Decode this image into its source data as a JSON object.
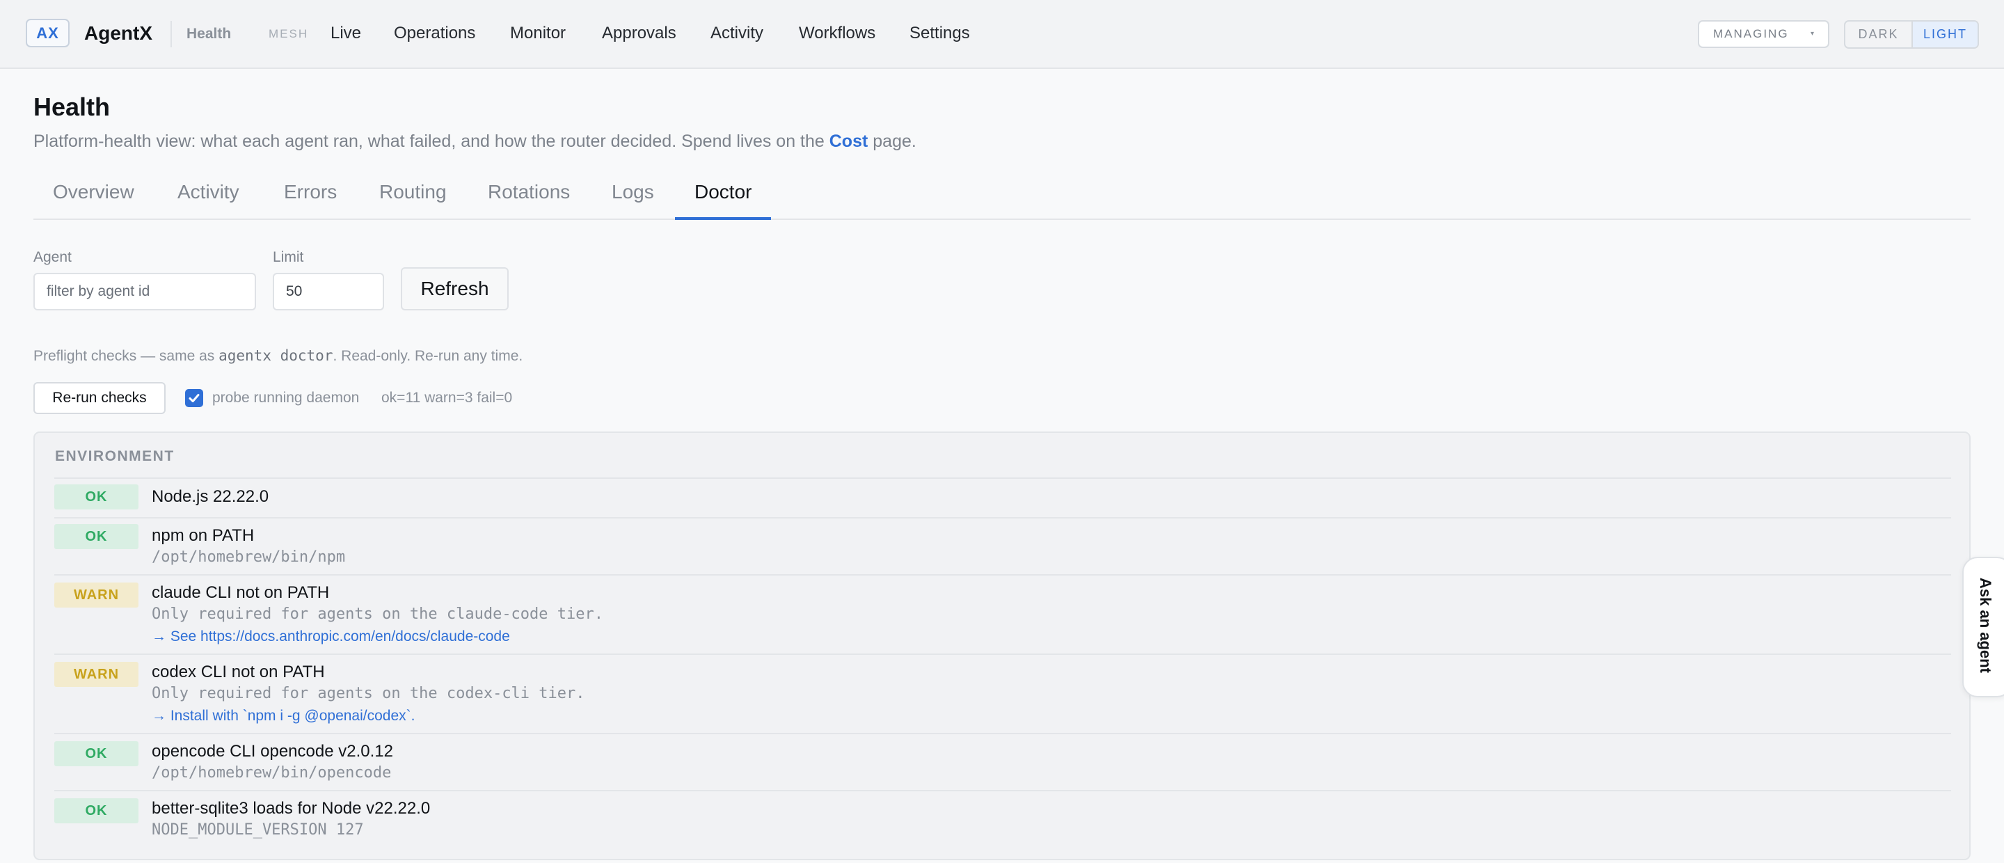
{
  "app": {
    "logo": "AX",
    "name": "AgentX",
    "crumb": "Health",
    "mesh": "MESH"
  },
  "nav": [
    "Live",
    "Operations",
    "Monitor",
    "Approvals",
    "Activity",
    "Workflows",
    "Settings"
  ],
  "managing": {
    "label": "MANAGING",
    "caret": "▾"
  },
  "theme": {
    "dark": "DARK",
    "light": "LIGHT",
    "active": "light"
  },
  "page": {
    "title": "Health",
    "subtitle_pre": "Platform-health view: what each agent ran, what failed, and how the router decided. Spend lives on the ",
    "subtitle_link": "Cost",
    "subtitle_post": " page."
  },
  "tabs": [
    "Overview",
    "Activity",
    "Errors",
    "Routing",
    "Rotations",
    "Logs",
    "Doctor"
  ],
  "active_tab": "Doctor",
  "filters": {
    "agent_label": "Agent",
    "agent_placeholder": "filter by agent id",
    "limit_label": "Limit",
    "limit_value": "50",
    "refresh_label": "Refresh"
  },
  "preflight": {
    "pre": "Preflight checks — same as ",
    "command": "agentx doctor",
    "post": ". Read-only. Re-run any time.",
    "rerun_label": "Re-run checks",
    "probe_label": "probe running daemon",
    "probe_checked": true,
    "summary": "ok=11 warn=3 fail=0"
  },
  "environment": {
    "title": "ENVIRONMENT",
    "checks": [
      {
        "status": "OK",
        "title": "Node.js 22.22.0",
        "detail": "",
        "link": ""
      },
      {
        "status": "OK",
        "title": "npm on PATH",
        "detail": "/opt/homebrew/bin/npm",
        "link": ""
      },
      {
        "status": "WARN",
        "title": "claude CLI not on PATH",
        "detail": "Only required for agents on the claude-code tier.",
        "link": "→ See https://docs.anthropic.com/en/docs/claude-code"
      },
      {
        "status": "WARN",
        "title": "codex CLI not on PATH",
        "detail": "Only required for agents on the codex-cli tier.",
        "link": "→ Install with `npm i -g @openai/codex`."
      },
      {
        "status": "OK",
        "title": "opencode CLI opencode v2.0.12",
        "detail": "/opt/homebrew/bin/opencode",
        "link": ""
      },
      {
        "status": "OK",
        "title": "better-sqlite3 loads for Node v22.22.0",
        "detail": "NODE_MODULE_VERSION 127",
        "link": ""
      }
    ]
  },
  "ask_agent": "Ask an agent",
  "colors": {
    "accent": "#2f6fd6",
    "ok_bg": "#d9efe3",
    "ok_fg": "#2faa63",
    "warn_bg": "#f3ebcd",
    "warn_fg": "#c8a21c"
  }
}
